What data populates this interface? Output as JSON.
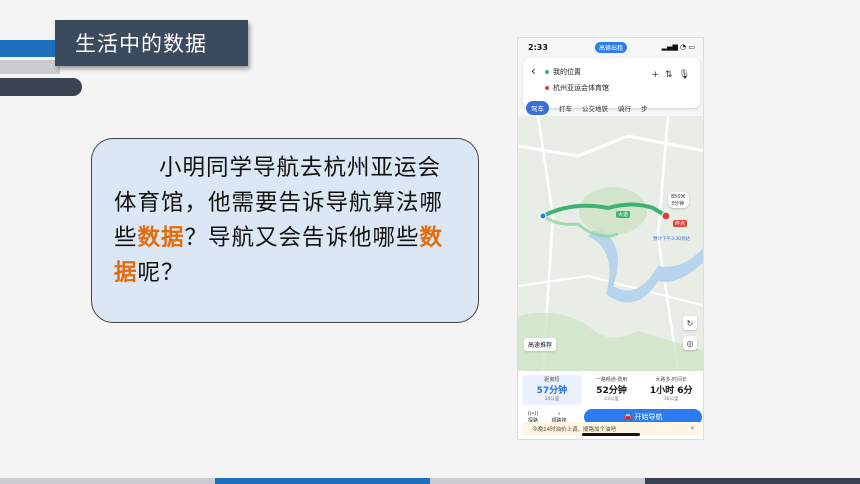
{
  "slide": {
    "title": "生活中的数据",
    "question_parts": [
      "小明同学导航去杭州亚运会体育馆，他需要告诉导航算法哪些",
      "数据",
      "？导航又会告诉他哪些",
      "数据",
      "呢？"
    ],
    "highlight_color": "#e46c0a"
  },
  "phone": {
    "status": {
      "time": "2:33",
      "app_badge": "高德出租"
    },
    "route": {
      "origin": "我的位置",
      "destination": "杭州亚运会体育馆"
    },
    "mode_tabs": [
      "驾车",
      "打车",
      "公交地铁",
      "骑行",
      "步"
    ],
    "map_labels": {
      "eta_badge": "850米",
      "eta_badge_time": "3分钟",
      "route_label": "大道",
      "dest_pin": "终点",
      "arrival": "预计下午3:30到达"
    },
    "route_pref": "高速推荐",
    "route_options": [
      {
        "tag": "距离短",
        "time": "57分钟",
        "dist": "34公里"
      },
      {
        "tag": "一路畅通·费用",
        "time": "52分钟",
        "dist": "43公里"
      },
      {
        "tag": "大路多·时间长",
        "time": "1小时 6分",
        "dist": "36公里"
      }
    ],
    "actions": [
      "探路",
      "顺路搜"
    ],
    "nav_button": "开始导航",
    "notice": "今晚24时油价上调，顺路加个油吧"
  },
  "colors": {
    "title_bg": "#3b4a5c",
    "accent_blue": "#1f6fbf",
    "bottom_bar": [
      "#c9ccd1",
      "#1f6fbf",
      "#c9ccd1",
      "#3b4252"
    ]
  }
}
